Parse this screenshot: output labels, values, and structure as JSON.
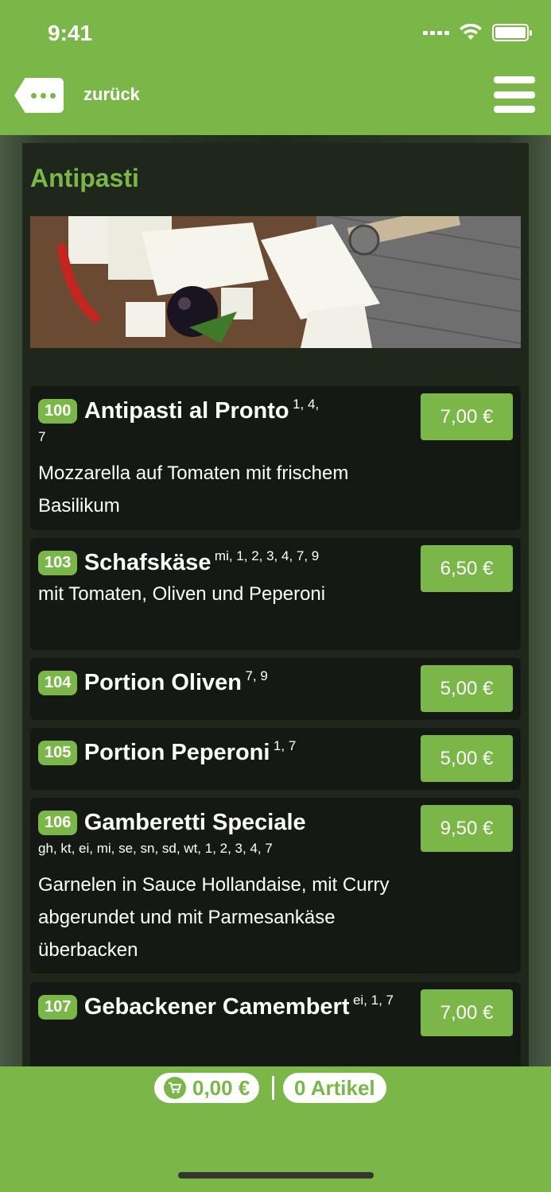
{
  "status": {
    "time": "9:41"
  },
  "header": {
    "back_label": "zurück"
  },
  "section": {
    "title": "Antipasti"
  },
  "items": [
    {
      "number": "100",
      "name": "Antipasti al Pronto",
      "allergens": "1, 4,",
      "allergens_cont": "7",
      "description": "Mozzarella auf Tomaten mit frischem Basilikum",
      "price": "7,00 €"
    },
    {
      "number": "103",
      "name": "Schafskäse",
      "allergens": "mi, 1, 2, 3, 4, 7, 9",
      "description": "mit Tomaten, Oliven und Peperoni",
      "price": "6,50 €"
    },
    {
      "number": "104",
      "name": "Portion Oliven",
      "allergens": "7, 9",
      "price": "5,00 €"
    },
    {
      "number": "105",
      "name": "Portion Peperoni",
      "allergens": "1, 7",
      "price": "5,00 €"
    },
    {
      "number": "106",
      "name": "Gamberetti Speciale",
      "allergens": "gh, kt, ei, mi, se, sn, sd, wt, 1, 2, 3, 4, 7",
      "description": "Garnelen in Sauce Hollandaise, mit Curry abgerundet und mit Parmesankäse überbacken",
      "price": "9,50 €"
    },
    {
      "number": "107",
      "name": "Gebackener Camembert",
      "allergens": "ei, 1, 7",
      "price": "7,00 €"
    }
  ],
  "cart": {
    "total": "0,00 €",
    "count": "0 Artikel"
  },
  "colors": {
    "accent": "#7ab648",
    "dark": "#141913"
  }
}
